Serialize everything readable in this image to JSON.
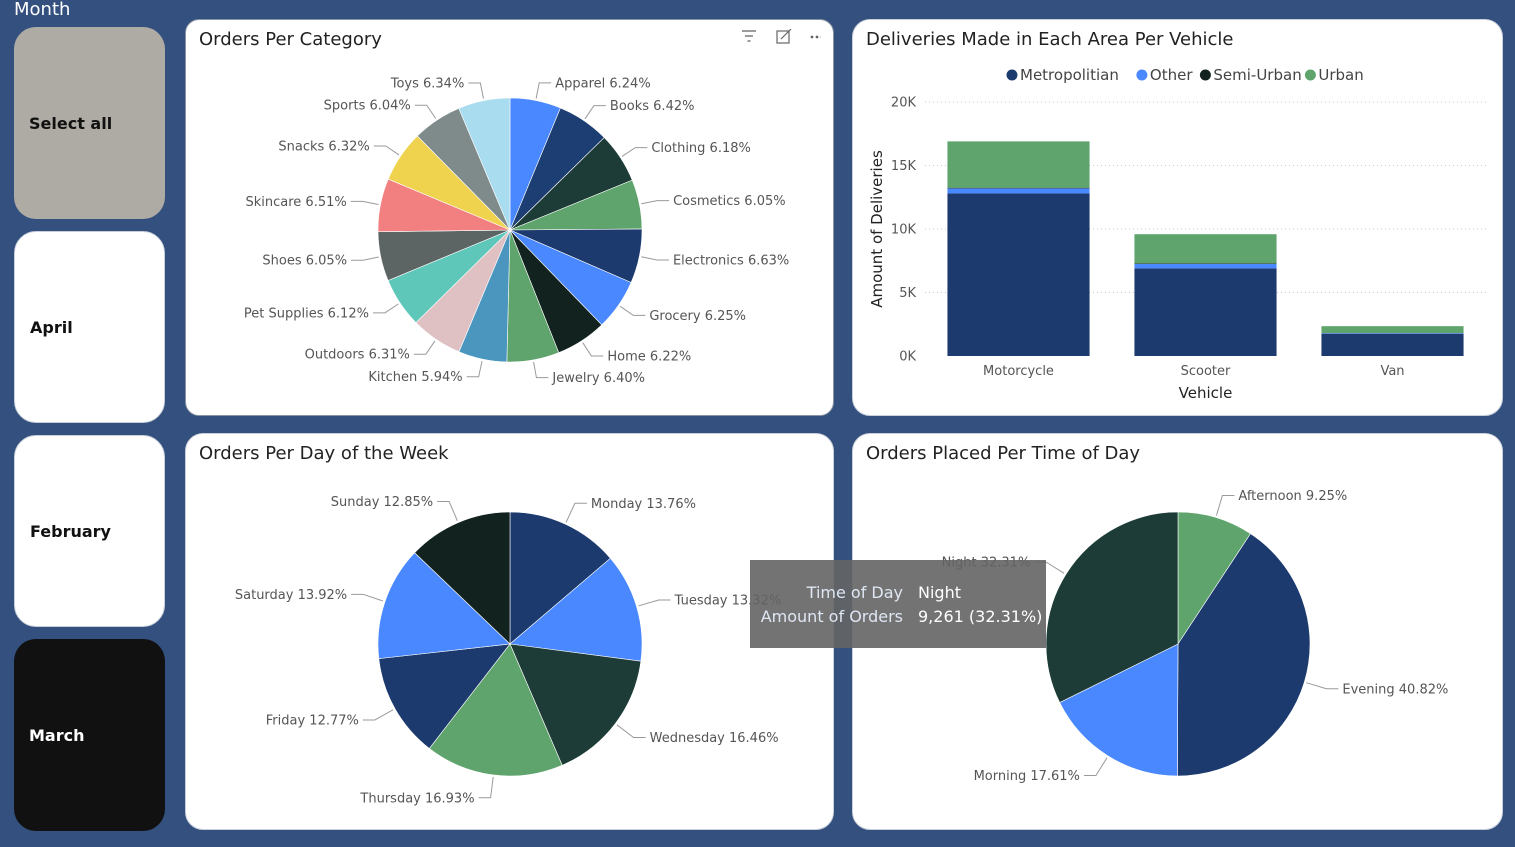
{
  "slicer": {
    "title": "Month",
    "buttons": [
      "Select all",
      "April",
      "February",
      "March"
    ]
  },
  "visual_header_icons": [
    "filter-icon",
    "focus-mode-icon",
    "more-options-icon"
  ],
  "tooltip": {
    "rows": [
      {
        "key": "Time of Day",
        "value": "Night"
      },
      {
        "key": "Amount of Orders",
        "value": "9,261 (32.31%)"
      }
    ]
  },
  "chart_data": [
    {
      "type": "pie",
      "title": "Orders Per Category",
      "slices": [
        {
          "label": "Apparel",
          "percent": 6.24,
          "text": "Apparel 6.24%",
          "color": "#4a88ff"
        },
        {
          "label": "Books",
          "percent": 6.42,
          "text": "Books 6.42%",
          "color": "#1c3e73"
        },
        {
          "label": "Clothing",
          "percent": 6.18,
          "text": "Clothing 6.18%",
          "color": "#1d3c37"
        },
        {
          "label": "Cosmetics",
          "percent": 6.05,
          "text": "Cosmetics 6.05%",
          "color": "#5fa46c"
        },
        {
          "label": "Electronics",
          "percent": 6.63,
          "text": "Electronics 6.63%",
          "color": "#1c3a6e"
        },
        {
          "label": "Grocery",
          "percent": 6.25,
          "text": "Grocery 6.25%",
          "color": "#4a88ff"
        },
        {
          "label": "Home",
          "percent": 6.22,
          "text": "Home 6.22%",
          "color": "#11221f"
        },
        {
          "label": "Jewelry",
          "percent": 6.4,
          "text": "Jewelry 6.40%",
          "color": "#5fa46c"
        },
        {
          "label": "Kitchen",
          "percent": 5.94,
          "text": "Kitchen 5.94%",
          "color": "#4a96be"
        },
        {
          "label": "Outdoors",
          "percent": 6.31,
          "text": "Outdoors 6.31%",
          "color": "#dfc1c3"
        },
        {
          "label": "Pet Supplies",
          "percent": 6.12,
          "text": "Pet Supplies 6.12%",
          "color": "#5ec7ba"
        },
        {
          "label": "Shoes",
          "percent": 6.05,
          "text": "Shoes 6.05%",
          "color": "#5c6564"
        },
        {
          "label": "Skincare",
          "percent": 6.51,
          "text": "Skincare 6.51%",
          "color": "#f28080"
        },
        {
          "label": "Snacks",
          "percent": 6.32,
          "text": "Snacks 6.32%",
          "color": "#efd34e"
        },
        {
          "label": "Sports",
          "percent": 6.04,
          "text": "Sports 6.04%",
          "color": "#7f8b8b"
        },
        {
          "label": "Toys",
          "percent": 6.34,
          "text": "Toys 6.34%",
          "color": "#a8dcee"
        }
      ]
    },
    {
      "type": "bar",
      "stacked": true,
      "title": "Deliveries Made in Each Area Per Vehicle",
      "xlabel": "Vehicle",
      "ylabel": "Amount of Deliveries",
      "categories": [
        "Motorcycle",
        "Scooter",
        "Van"
      ],
      "ylim": [
        0,
        20000
      ],
      "yticks": [
        "0K",
        "5K",
        "10K",
        "15K",
        "20K"
      ],
      "legend_position": "top",
      "series": [
        {
          "name": "Metropolitian",
          "color": "#1c3a6e",
          "values": [
            12800,
            6900,
            1750
          ]
        },
        {
          "name": "Other",
          "color": "#4a88ff",
          "values": [
            400,
            350,
            50
          ]
        },
        {
          "name": "Semi-Urban",
          "color": "#11221f",
          "values": [
            50,
            40,
            10
          ]
        },
        {
          "name": "Urban",
          "color": "#5fa46c",
          "values": [
            3650,
            2300,
            540
          ]
        }
      ]
    },
    {
      "type": "pie",
      "title": "Orders Per Day of the Week",
      "slices": [
        {
          "label": "Monday",
          "percent": 13.76,
          "text": "Monday 13.76%",
          "color": "#1c3a6e"
        },
        {
          "label": "Tuesday",
          "percent": 13.32,
          "text": "Tuesday 13.32%",
          "color": "#4a88ff"
        },
        {
          "label": "Wednesday",
          "percent": 16.46,
          "text": "Wednesday 16.46%",
          "color": "#1d3c37"
        },
        {
          "label": "Thursday",
          "percent": 16.93,
          "text": "Thursday 16.93%",
          "color": "#5fa46c"
        },
        {
          "label": "Friday",
          "percent": 12.77,
          "text": "Friday 12.77%",
          "color": "#1c3a6e"
        },
        {
          "label": "Saturday",
          "percent": 13.92,
          "text": "Saturday 13.92%",
          "color": "#4a88ff"
        },
        {
          "label": "Sunday",
          "percent": 12.85,
          "text": "Sunday 12.85%",
          "color": "#11221f"
        }
      ]
    },
    {
      "type": "pie",
      "title": "Orders Placed Per Time of Day",
      "slices": [
        {
          "label": "Afternoon",
          "percent": 9.25,
          "text": "Afternoon 9.25%",
          "color": "#5fa46c"
        },
        {
          "label": "Evening",
          "percent": 40.82,
          "text": "Evening 40.82%",
          "color": "#1c3a6e"
        },
        {
          "label": "Morning",
          "percent": 17.61,
          "text": "Morning 17.61%",
          "color": "#4a88ff"
        },
        {
          "label": "Night",
          "percent": 32.31,
          "text": "Night 32.31%",
          "color": "#1d3c37"
        }
      ]
    }
  ]
}
